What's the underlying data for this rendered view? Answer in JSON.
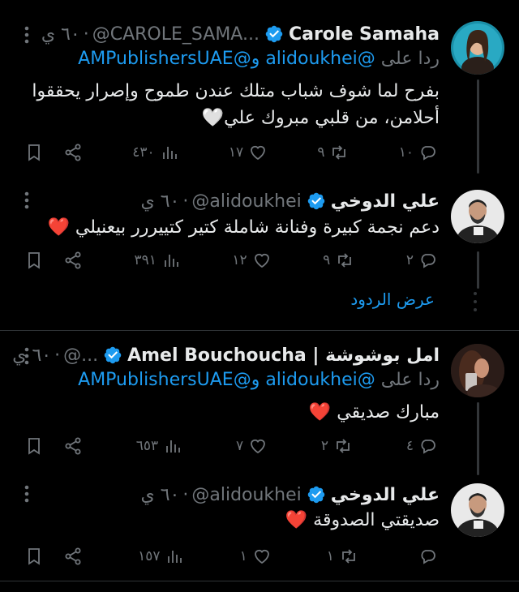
{
  "tweets": [
    {
      "name": "Carole Samaha",
      "handle": "@CAROLE_SAMA...",
      "time": "٦٠ ي",
      "reply_prefix": "ردا على",
      "reply_users": "@alidoukhei و@AMPublishersUAE",
      "text_line1": "بفرح لما شوف شباب متلك عندن طموح وإصرار يحققوا",
      "text_line2": "أحلامن، من قلبي مبروك علي🤍",
      "replies": "١٠",
      "retweets": "٩",
      "likes": "١٧",
      "views": "٤٣٠"
    },
    {
      "name": "علي الدوخي",
      "handle": "@alidoukhei",
      "time": "٦٠ ي",
      "text_line1": "دعم نجمة كبيرة وفنانة شاملة كتير كتييررر بيعنيلي ❤️",
      "replies": "٢",
      "retweets": "٩",
      "likes": "١٢",
      "views": "٣٩١",
      "show_replies": "عرض الردود"
    },
    {
      "name": "Amel Bouchoucha | امل بوشوشة",
      "handle": "@...",
      "time": "٦٠ ي",
      "reply_prefix": "ردا على",
      "reply_users": "@alidoukhei و@AMPublishersUAE",
      "text_line1": "مبارك صديقي ❤️",
      "replies": "٤",
      "retweets": "٢",
      "likes": "٧",
      "views": "٦٥٣"
    },
    {
      "name": "علي الدوخي",
      "handle": "@alidoukhei",
      "time": "٦٠ ي",
      "text_line1": "صديقتي الصدوقة ❤️",
      "replies": "",
      "retweets": "١",
      "likes": "١",
      "views": "١٥٧"
    }
  ],
  "colors": {
    "background": "#000000",
    "text": "#e7e9ea",
    "muted": "#71767b",
    "accent": "#1d9bf0",
    "divider": "#2f3336"
  },
  "icons": {
    "more": "more-icon",
    "verified": "verified-badge-icon",
    "reply": "reply-icon",
    "retweet": "retweet-icon",
    "like": "heart-icon",
    "views": "views-icon",
    "bookmark": "bookmark-icon",
    "share": "share-icon"
  }
}
